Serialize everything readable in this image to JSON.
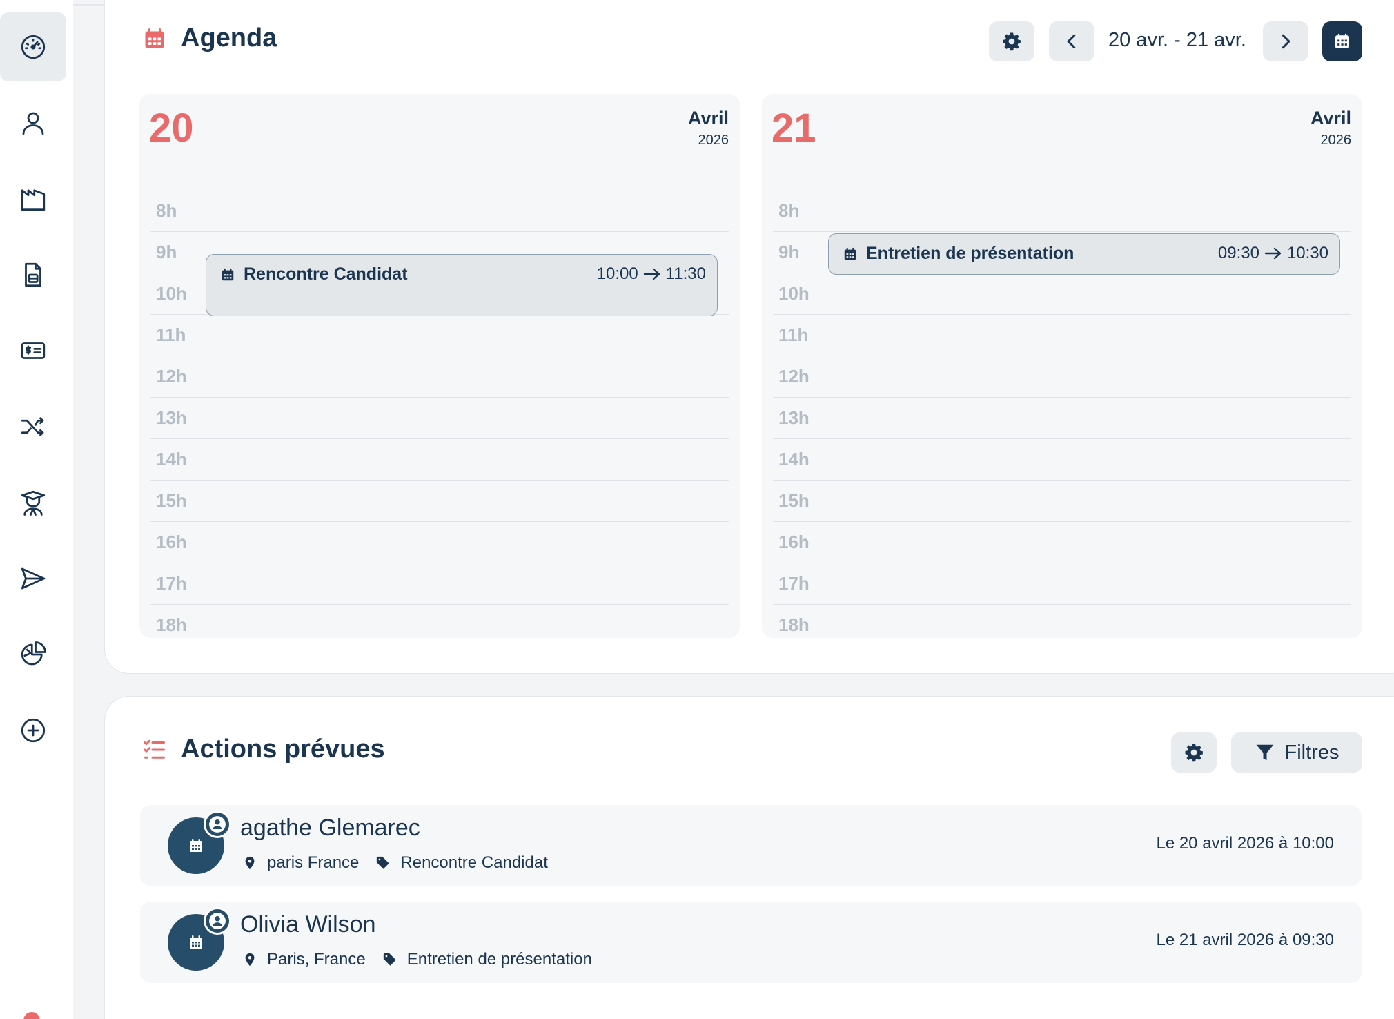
{
  "agenda": {
    "title": "Agenda",
    "range_label": "20 avr. - 21 avr.",
    "days": [
      {
        "day": "20",
        "month": "Avril",
        "year": "2026",
        "hours": [
          "8h",
          "9h",
          "10h",
          "11h",
          "12h",
          "13h",
          "14h",
          "15h",
          "16h",
          "17h",
          "18h"
        ],
        "event": {
          "title": "Rencontre Candidat",
          "start": "10:00",
          "end": "11:30"
        }
      },
      {
        "day": "21",
        "month": "Avril",
        "year": "2026",
        "hours": [
          "8h",
          "9h",
          "10h",
          "11h",
          "12h",
          "13h",
          "14h",
          "15h",
          "16h",
          "17h",
          "18h"
        ],
        "event": {
          "title": "Entretien de présentation",
          "start": "09:30",
          "end": "10:30"
        }
      }
    ]
  },
  "actions": {
    "title": "Actions prévues",
    "filter_label": "Filtres",
    "items": [
      {
        "name": "agathe Glemarec",
        "location": "paris France",
        "tag": "Rencontre Candidat",
        "date": "Le 20 avril 2026 à 10:00"
      },
      {
        "name": "Olivia Wilson",
        "location": "Paris, France",
        "tag": "Entretien de présentation",
        "date": "Le 21 avril 2026 à 09:30"
      }
    ]
  },
  "sidebar": {
    "icons": [
      "dashboard-gauge-icon",
      "user-icon",
      "factory-icon",
      "document-icon",
      "invoice-dollar-icon",
      "shuffle-icon",
      "student-icon",
      "send-icon",
      "pie-chart-icon",
      "add-circle-icon"
    ]
  },
  "colors": {
    "accent": "#e86a6a",
    "primary": "#1b3550",
    "avatar": "#264e6a"
  }
}
